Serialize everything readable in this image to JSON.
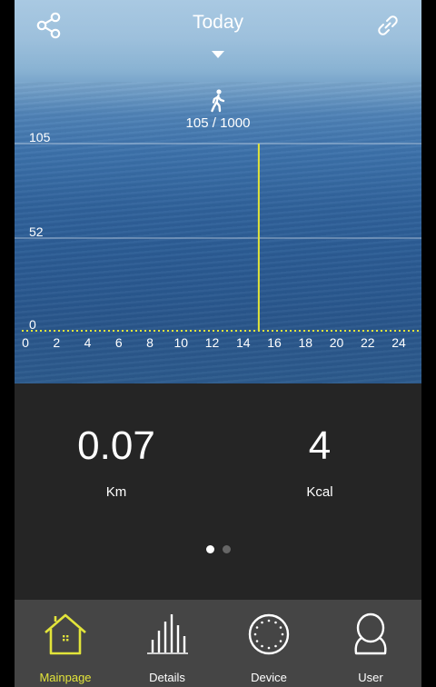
{
  "header": {
    "title": "Today",
    "goal_text": "105 / 1000",
    "share_icon": "share-icon",
    "link_icon": "link-icon",
    "dropdown_icon": "caret-down-icon",
    "walker_icon": "walking-person-icon"
  },
  "chart_data": {
    "type": "bar",
    "x_ticks": [
      "0",
      "2",
      "4",
      "6",
      "8",
      "10",
      "12",
      "14",
      "16",
      "18",
      "20",
      "22",
      "24"
    ],
    "y_ticks": [
      "105",
      "52",
      "0"
    ],
    "xlim": [
      0,
      24
    ],
    "ylim": [
      0,
      105
    ],
    "values": [
      {
        "x": 15,
        "y": 105
      }
    ],
    "bar_color": "#e2e43a",
    "grid": true
  },
  "stats": {
    "distance_value": "0.07",
    "distance_unit": "Km",
    "calories_value": "4",
    "calories_unit": "Kcal"
  },
  "pager": {
    "count": 2,
    "active": 0
  },
  "nav": {
    "tabs": [
      {
        "label": "Mainpage",
        "icon": "home-icon",
        "active": true
      },
      {
        "label": "Details",
        "icon": "bar-chart-icon",
        "active": false
      },
      {
        "label": "Device",
        "icon": "device-watch-icon",
        "active": false
      },
      {
        "label": "User",
        "icon": "user-icon",
        "active": false
      }
    ]
  },
  "colors": {
    "accent": "#e2e43a",
    "stats_bg": "#252525",
    "nav_bg": "#454545"
  }
}
